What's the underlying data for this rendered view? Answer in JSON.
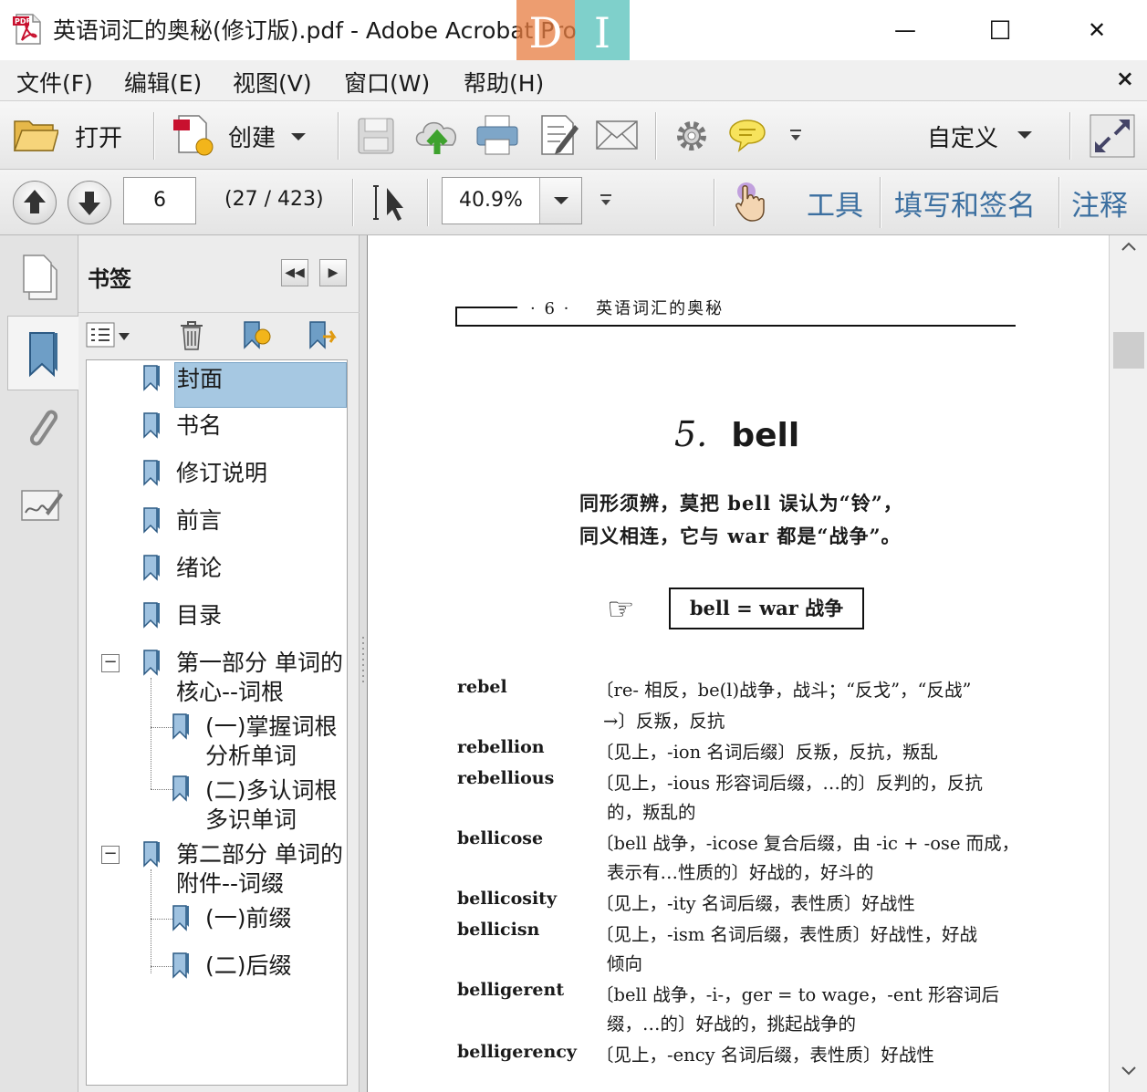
{
  "window": {
    "title": "英语词汇的奥秘(修订版).pdf - Adobe Acrobat Pro",
    "minimize": "—",
    "maximize": "☐",
    "close": "✕",
    "overlay_logo": {
      "left_letter": "D",
      "right_letter": "I"
    }
  },
  "menubar": {
    "items": [
      "文件(F)",
      "编辑(E)",
      "视图(V)",
      "窗口(W)",
      "帮助(H)"
    ],
    "close_glyph": "×"
  },
  "toolbar": {
    "open_label": "打开",
    "create_label": "创建",
    "customize_label": "自定义",
    "icons": [
      "folder-icon",
      "create-pdf-icon",
      "save-icon",
      "cloud-upload-icon",
      "print-icon",
      "edit-icon",
      "email-icon",
      "gear-icon",
      "comment-icon",
      "expand-icon"
    ]
  },
  "nav": {
    "page_value": "6",
    "page_count": "(27 / 423)",
    "zoom": "40.9%",
    "tools_link": "工具",
    "fill_sign_link": "填写和签名",
    "comment_link": "注释"
  },
  "bookmarks": {
    "title": "书签",
    "items": [
      {
        "label": "封面",
        "selected": true
      },
      {
        "label": "书名"
      },
      {
        "label": "修订说明"
      },
      {
        "label": "前言"
      },
      {
        "label": "绪论"
      },
      {
        "label": "目录"
      },
      {
        "label_line1": "第一部分 单词的",
        "label_line2": "核心--词根",
        "expanded": true,
        "children": [
          {
            "label_line1": "(一)掌握词根",
            "label_line2": "分析单词"
          },
          {
            "label_line1": "(二)多认词根",
            "label_line2": "多识单词"
          }
        ]
      },
      {
        "label_line1": "第二部分 单词的",
        "label_line2": "附件--词缀",
        "expanded": true,
        "children": [
          {
            "label": "(一)前缀"
          },
          {
            "label": "(二)后缀"
          }
        ]
      }
    ]
  },
  "document": {
    "header_page": "· 6 ·",
    "header_book": "英语词汇的奥秘",
    "chapter_number": "5.",
    "chapter_word": "bell",
    "subtitle_line1": "同形须辨，莫把 bell 误认为“铃”，",
    "subtitle_line2": "同义相连，它与 war 都是“战争”。",
    "pointer_glyph": "☞",
    "formula": "bell  =  war 战争",
    "entries": [
      {
        "term": "rebel",
        "def": [
          "〔re- 相反，be(l)战争，战斗；“反戈”，“反战”",
          "→〕反叛，反抗"
        ]
      },
      {
        "term": "rebellion",
        "def": [
          "〔见上，-ion 名词后缀〕反叛，反抗，叛乱"
        ]
      },
      {
        "term": "rebellious",
        "def": [
          "〔见上，-ious 形容词后缀，…的〕反判的，反抗",
          "的，叛乱的"
        ]
      },
      {
        "term": "bellicose",
        "def": [
          "〔bell 战争，-icose 复合后缀，由 -ic + -ose 而成，",
          "表示有…性质的〕好战的，好斗的"
        ]
      },
      {
        "term": "bellicosity",
        "def": [
          "〔见上，-ity 名词后缀，表性质〕好战性"
        ]
      },
      {
        "term": "bellicisn",
        "def": [
          "〔见上，-ism 名词后缀，表性质〕好战性，好战",
          "倾向"
        ]
      },
      {
        "term": "belligerent",
        "def": [
          "〔bell 战争，-i-，ger = to wage，-ent 形容词后",
          "缀，…的〕好战的，挑起战争的"
        ]
      },
      {
        "term": "belligerency",
        "def": [
          "〔见上，-ency 名词后缀，表性质〕好战性"
        ]
      }
    ]
  }
}
